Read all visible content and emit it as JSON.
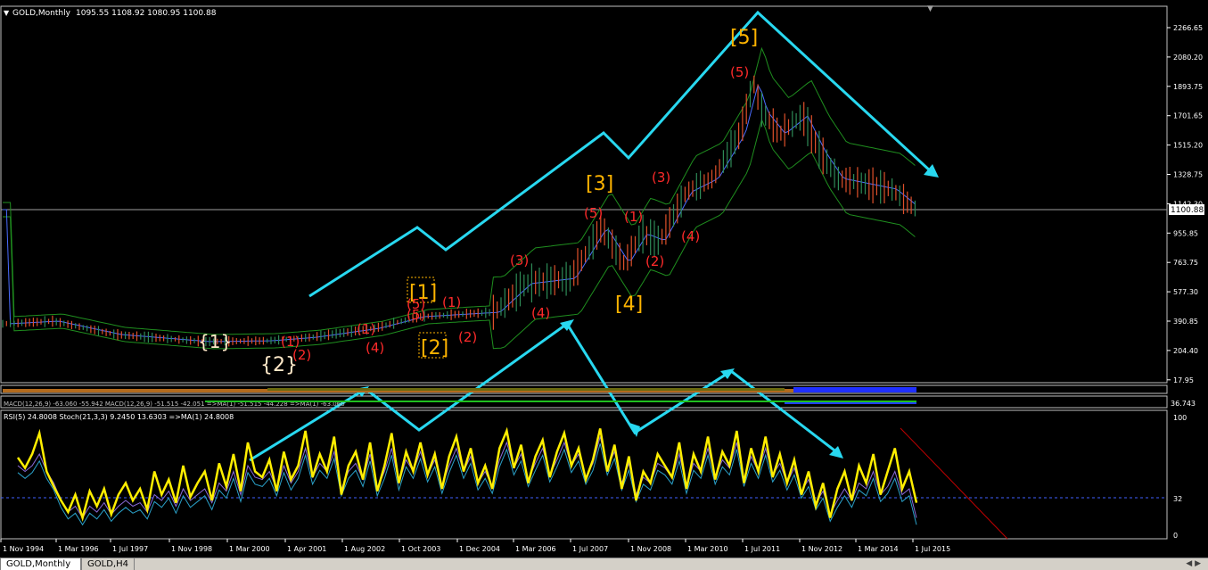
{
  "main_header": {
    "title": "GOLD,Monthly",
    "ohlc": "1095.55 1108.92 1080.95 1100.88"
  },
  "colors": {
    "bg": "#000000",
    "up_bar": "#2e8b57",
    "down_bar": "#e0502a",
    "band": "#1f8f1f",
    "ma": "#4a6cff",
    "arrow": "#28d8f0",
    "wave_red": "#ff2a2a",
    "wave_orange": "#ffb400",
    "wave_white": "#ffe8c8",
    "rsi": "#ffee00"
  },
  "price_axis": [
    "2266.65",
    "2080.20",
    "1893.75",
    "1701.65",
    "1515.20",
    "1328.75",
    "1142.30",
    "955.85",
    "763.75",
    "577.30",
    "390.85",
    "204.40",
    "17.95"
  ],
  "current_price": "1100.88",
  "waves": {
    "cycle": [
      "{1}",
      "{2}"
    ],
    "primary": [
      "[1]",
      "[2]",
      "[3]",
      "[4]",
      "[5]"
    ],
    "intermediate": [
      "(1)",
      "(2)",
      "(3)",
      "(4)",
      "(5)",
      "(1)",
      "(4)",
      "(5)",
      "(1)",
      "(2)",
      "(3)",
      "(4)",
      "(5)",
      "(1)",
      "(2)",
      "(3)",
      "(4)",
      "(5)"
    ]
  },
  "macd_header": "MACD(12,26,9) -63.060 -55.942  MACD(12,26,9) -51.515 -42.051  =>MA(1) -51.515 -44.228  =>MA(1) -63.060",
  "macd_axis": "36.743",
  "rsi_header": "RSI(5) 24.8008  Stoch(21,3,3) 9.2450 13.6303  =>MA(1) 24.8008",
  "rsi_axis": [
    "100",
    "32",
    "0"
  ],
  "time_axis": [
    "1 Nov 1994",
    "1 Mar 1996",
    "1 Jul 1997",
    "1 Nov 1998",
    "1 Mar 2000",
    "1 Apr 2001",
    "1 Aug 2002",
    "1 Oct 2003",
    "1 Dec 2004",
    "1 Mar 2006",
    "1 Jul 2007",
    "1 Nov 2008",
    "1 Mar 2010",
    "1 Jul 2011",
    "1 Nov 2012",
    "1 Mar 2014",
    "1 Jul 2015"
  ],
  "tabs": [
    "GOLD,Monthly",
    "GOLD,H4"
  ],
  "rsi_series": [
    67,
    58,
    70,
    88,
    55,
    42,
    30,
    20,
    35,
    15,
    38,
    25,
    40,
    18,
    35,
    45,
    30,
    40,
    22,
    55,
    35,
    48,
    28,
    60,
    33,
    45,
    55,
    30,
    62,
    42,
    70,
    38,
    80,
    55,
    50,
    65,
    38,
    72,
    48,
    60,
    90,
    50,
    70,
    55,
    85,
    35,
    60,
    72,
    48,
    80,
    38,
    60,
    88,
    45,
    72,
    55,
    80,
    52,
    70,
    40,
    68,
    85,
    55,
    75,
    45,
    60,
    40,
    75,
    90,
    58,
    78,
    45,
    68,
    82,
    50,
    72,
    88,
    60,
    75,
    48,
    65,
    92,
    55,
    78,
    40,
    68,
    30,
    55,
    45,
    70,
    60,
    50,
    80,
    40,
    70,
    55,
    85,
    48,
    72,
    60,
    90,
    45,
    75,
    55,
    85,
    50,
    70,
    45,
    65,
    35,
    55,
    25,
    45,
    15,
    40,
    55,
    30,
    60,
    45,
    70,
    35,
    55,
    75,
    40,
    55,
    28
  ],
  "stoch_series": [
    60,
    55,
    60,
    70,
    55,
    45,
    30,
    20,
    25,
    15,
    25,
    20,
    28,
    18,
    25,
    30,
    25,
    28,
    20,
    35,
    30,
    38,
    25,
    40,
    30,
    35,
    40,
    28,
    45,
    38,
    55,
    35,
    60,
    50,
    48,
    55,
    40,
    60,
    45,
    55,
    75,
    50,
    62,
    55,
    72,
    40,
    55,
    62,
    48,
    70,
    40,
    55,
    75,
    45,
    65,
    55,
    72,
    52,
    65,
    42,
    60,
    75,
    55,
    68,
    45,
    55,
    42,
    65,
    80,
    58,
    70,
    48,
    62,
    75,
    52,
    65,
    80,
    60,
    70,
    50,
    62,
    85,
    58,
    72,
    45,
    62,
    35,
    50,
    45,
    62,
    58,
    50,
    70,
    42,
    62,
    55,
    75,
    50,
    65,
    58,
    80,
    48,
    68,
    55,
    75,
    52,
    62,
    45,
    58,
    38,
    48,
    28,
    38,
    18,
    30,
    40,
    30,
    45,
    40,
    55,
    35,
    42,
    55,
    35,
    40,
    15
  ]
}
